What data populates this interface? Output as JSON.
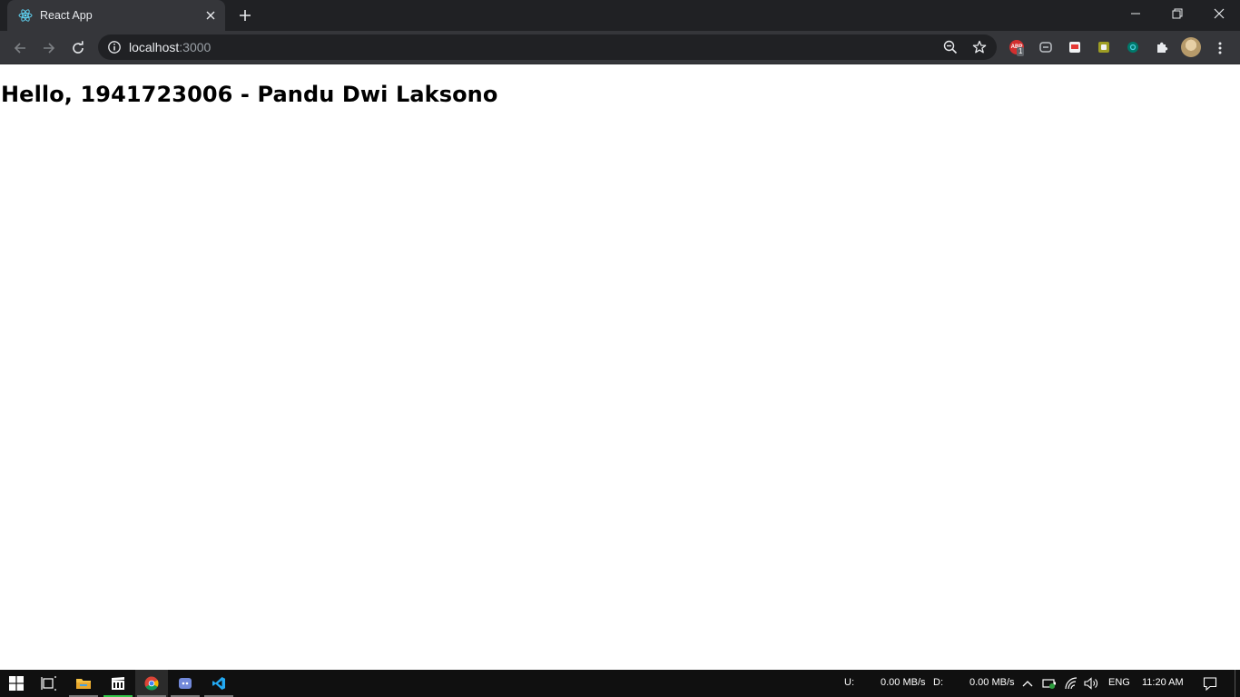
{
  "browser": {
    "tab": {
      "title": "React App",
      "favicon": "react-icon"
    },
    "address": {
      "host": "localhost",
      "port": ":3000"
    },
    "extensions": [
      {
        "name": "adblock-icon",
        "badge": "1"
      },
      {
        "name": "extension-icon"
      },
      {
        "name": "extension-icon"
      },
      {
        "name": "extension-icon"
      },
      {
        "name": "extension-icon"
      },
      {
        "name": "puzzle-icon"
      }
    ]
  },
  "page": {
    "heading": "Hello, 1941723006 - Pandu Dwi Laksono"
  },
  "taskbar": {
    "apps": [
      "windows-start-icon",
      "task-view-icon",
      "file-explorer-icon",
      "media-app-icon",
      "chrome-icon",
      "discord-icon",
      "vscode-icon"
    ],
    "tray": {
      "upload_label": "U:",
      "upload_value": "0.00 MB/s",
      "download_label": "D:",
      "download_value": "0.00 MB/s",
      "language": "ENG",
      "time": "11:20 AM"
    }
  },
  "colors": {
    "chrome_dark": "#202124",
    "chrome_toolbar": "#35363a",
    "taskbar": "#101010",
    "react": "#61dafb"
  }
}
